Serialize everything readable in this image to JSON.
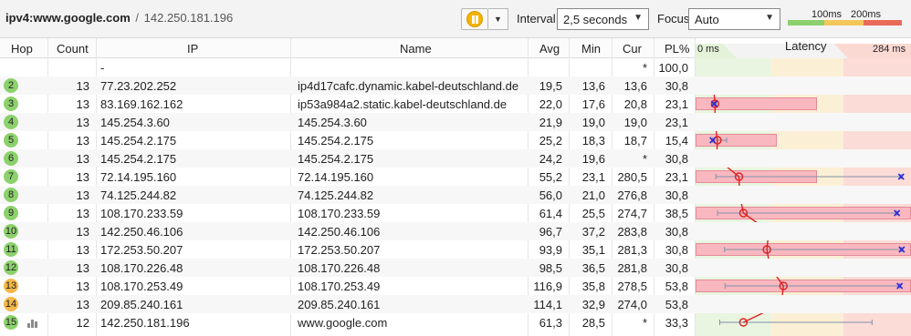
{
  "toolbar": {
    "host": "ipv4:www.google.com",
    "separator": "/",
    "ip": "142.250.181.196",
    "interval_label": "Interval",
    "interval_value": "2,5 seconds",
    "focus_label": "Focus",
    "focus_value": "Auto",
    "scale_100": "100ms",
    "scale_200": "200ms"
  },
  "colors": {
    "good": "#8cd16c",
    "warn": "#f4c75b",
    "bad": "#ea6a5a",
    "hop_green": "#8cd16c",
    "hop_orange": "#f4b84a",
    "line": "#e02020"
  },
  "columns": {
    "hop": "Hop",
    "count": "Count",
    "ip": "IP",
    "name": "Name",
    "avg": "Avg",
    "min": "Min",
    "cur": "Cur",
    "pl": "PL%",
    "latency_min": "0 ms",
    "latency": "Latency",
    "latency_max": "284 ms"
  },
  "latency_max_ms": 284,
  "rows": [
    {
      "hop": "",
      "count": "",
      "ip": "-",
      "name": "",
      "avg": "",
      "min": "",
      "cur": "*",
      "pl": "100,0",
      "status": "none"
    },
    {
      "hop": "2",
      "count": "13",
      "ip": "77.23.202.252",
      "name": "ip4d17cafc.dynamic.kabel-deutschland.de",
      "avg": "19,5",
      "min": "13,6",
      "cur": "13,6",
      "pl": "30,8",
      "status": "green",
      "avg_ms": 19.5,
      "min_ms": 13.6,
      "max_ms": 22,
      "cur_ms": 13.6,
      "pl_bar": 1.0
    },
    {
      "hop": "3",
      "count": "13",
      "ip": "83.169.162.162",
      "name": "ip53a984a2.static.kabel-deutschland.de",
      "avg": "22,0",
      "min": "17,6",
      "cur": "20,8",
      "pl": "23,1",
      "status": "green",
      "avg_ms": 22.0,
      "min_ms": 17.6,
      "max_ms": 24,
      "cur_ms": 20.8,
      "pl_bar": 0.75
    },
    {
      "hop": "4",
      "count": "13",
      "ip": "145.254.3.60",
      "name": "145.254.3.60",
      "avg": "21,9",
      "min": "19,0",
      "cur": "19,0",
      "pl": "23,1",
      "status": "green",
      "avg_ms": 21.9,
      "min_ms": 19.0,
      "max_ms": 24,
      "cur_ms": 19.0,
      "pl_bar": 0.75
    },
    {
      "hop": "5",
      "count": "13",
      "ip": "145.254.2.175",
      "name": "145.254.2.175",
      "avg": "25,2",
      "min": "18,3",
      "cur": "18,7",
      "pl": "15,4",
      "status": "green",
      "avg_ms": 25.2,
      "min_ms": 18.3,
      "max_ms": 38,
      "cur_ms": 18.7,
      "pl_bar": 0.5
    },
    {
      "hop": "6",
      "count": "13",
      "ip": "145.254.2.175",
      "name": "145.254.2.175",
      "avg": "24,2",
      "min": "19,6",
      "cur": "*",
      "pl": "30,8",
      "status": "green",
      "avg_ms": 24.2,
      "min_ms": 19.6,
      "max_ms": 26,
      "cur_ms": null,
      "pl_bar": 1.0
    },
    {
      "hop": "7",
      "count": "13",
      "ip": "72.14.195.160",
      "name": "72.14.195.160",
      "avg": "55,2",
      "min": "23,1",
      "cur": "280,5",
      "pl": "23,1",
      "status": "green",
      "avg_ms": 55.2,
      "min_ms": 23.1,
      "max_ms": 280.5,
      "cur_ms": 280.5,
      "pl_bar": 0.75
    },
    {
      "hop": "8",
      "count": "13",
      "ip": "74.125.244.82",
      "name": "74.125.244.82",
      "avg": "56,0",
      "min": "21,0",
      "cur": "276,8",
      "pl": "30,8",
      "status": "green",
      "avg_ms": 56.0,
      "min_ms": 21.0,
      "max_ms": 276.8,
      "cur_ms": 276.8,
      "pl_bar": 1.0
    },
    {
      "hop": "9",
      "count": "13",
      "ip": "108.170.233.59",
      "name": "108.170.233.59",
      "avg": "61,4",
      "min": "25,5",
      "cur": "274,7",
      "pl": "38,5",
      "status": "green",
      "avg_ms": 61.4,
      "min_ms": 25.5,
      "max_ms": 274.7,
      "cur_ms": 274.7,
      "pl_bar": 1.0
    },
    {
      "hop": "10",
      "count": "13",
      "ip": "142.250.46.106",
      "name": "142.250.46.106",
      "avg": "96,7",
      "min": "37,2",
      "cur": "283,8",
      "pl": "30,8",
      "status": "green",
      "avg_ms": 96.7,
      "min_ms": 37.2,
      "max_ms": 283.8,
      "cur_ms": 283.8,
      "pl_bar": 1.0
    },
    {
      "hop": "11",
      "count": "13",
      "ip": "172.253.50.207",
      "name": "172.253.50.207",
      "avg": "93,9",
      "min": "35,1",
      "cur": "281,3",
      "pl": "30,8",
      "status": "green",
      "avg_ms": 93.9,
      "min_ms": 35.1,
      "max_ms": 281.3,
      "cur_ms": 281.3,
      "pl_bar": 1.0
    },
    {
      "hop": "12",
      "count": "13",
      "ip": "108.170.226.48",
      "name": "108.170.226.48",
      "avg": "98,5",
      "min": "36,5",
      "cur": "281,8",
      "pl": "30,8",
      "status": "green",
      "avg_ms": 98.5,
      "min_ms": 36.5,
      "max_ms": 281.8,
      "cur_ms": 281.8,
      "pl_bar": 1.0
    },
    {
      "hop": "13",
      "count": "13",
      "ip": "108.170.253.49",
      "name": "108.170.253.49",
      "avg": "116,9",
      "min": "35,8",
      "cur": "278,5",
      "pl": "53,8",
      "status": "orange",
      "avg_ms": 116.9,
      "min_ms": 35.8,
      "max_ms": 278.5,
      "cur_ms": 278.5,
      "pl_bar": 1.0
    },
    {
      "hop": "14",
      "count": "13",
      "ip": "209.85.240.161",
      "name": "209.85.240.161",
      "avg": "114,1",
      "min": "32,9",
      "cur": "274,0",
      "pl": "53,8",
      "status": "orange",
      "avg_ms": 114.1,
      "min_ms": 32.9,
      "max_ms": 274.0,
      "cur_ms": 274.0,
      "pl_bar": 1.0
    },
    {
      "hop": "15",
      "count": "12",
      "ip": "142.250.181.196",
      "name": "www.google.com",
      "avg": "61,3",
      "min": "28,5",
      "cur": "*",
      "pl": "33,3",
      "status": "green",
      "avg_ms": 61.3,
      "min_ms": 28.5,
      "max_ms": 240,
      "cur_ms": null,
      "pl_bar": 0.0,
      "has_chart_icon": true
    }
  ]
}
